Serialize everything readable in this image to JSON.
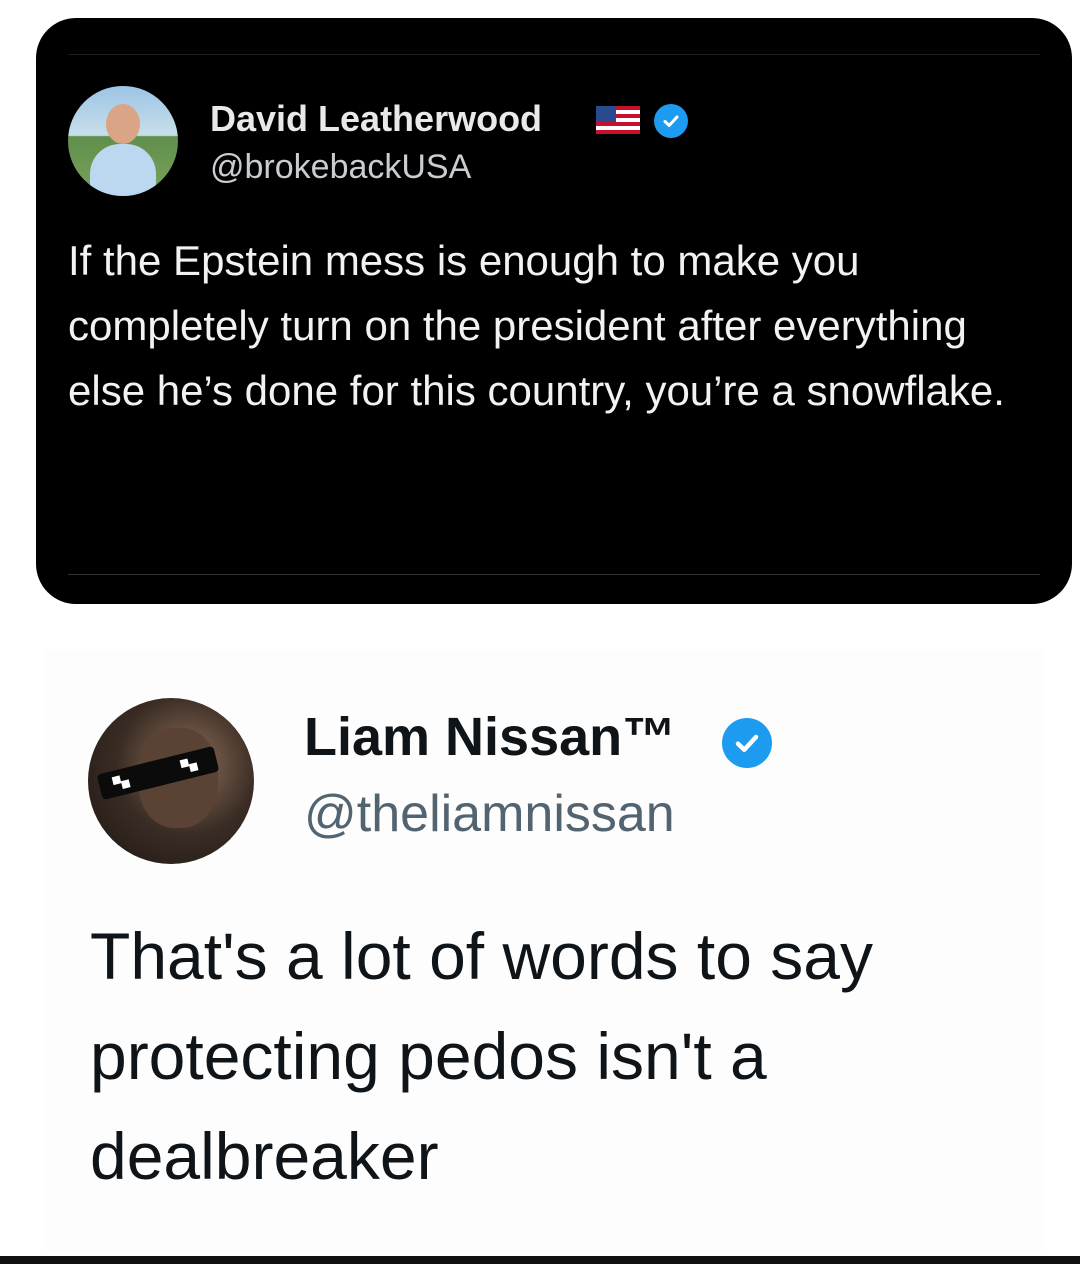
{
  "tweet1": {
    "display_name": "David Leatherwood",
    "flag_icon": "us-flag-icon",
    "verified_color": "#1d9bf0",
    "handle": "@brokebackUSA",
    "text": "If the Epstein mess is enough to make you completely turn on the president after everything else he’s done for this country, you’re a snowflake."
  },
  "tweet2": {
    "display_name": "Liam Nissan™",
    "verified_color": "#1d9bf0",
    "handle": "@theliamnissan",
    "text": "That's a lot of words to say protecting pedos isn't a dealbreaker"
  }
}
